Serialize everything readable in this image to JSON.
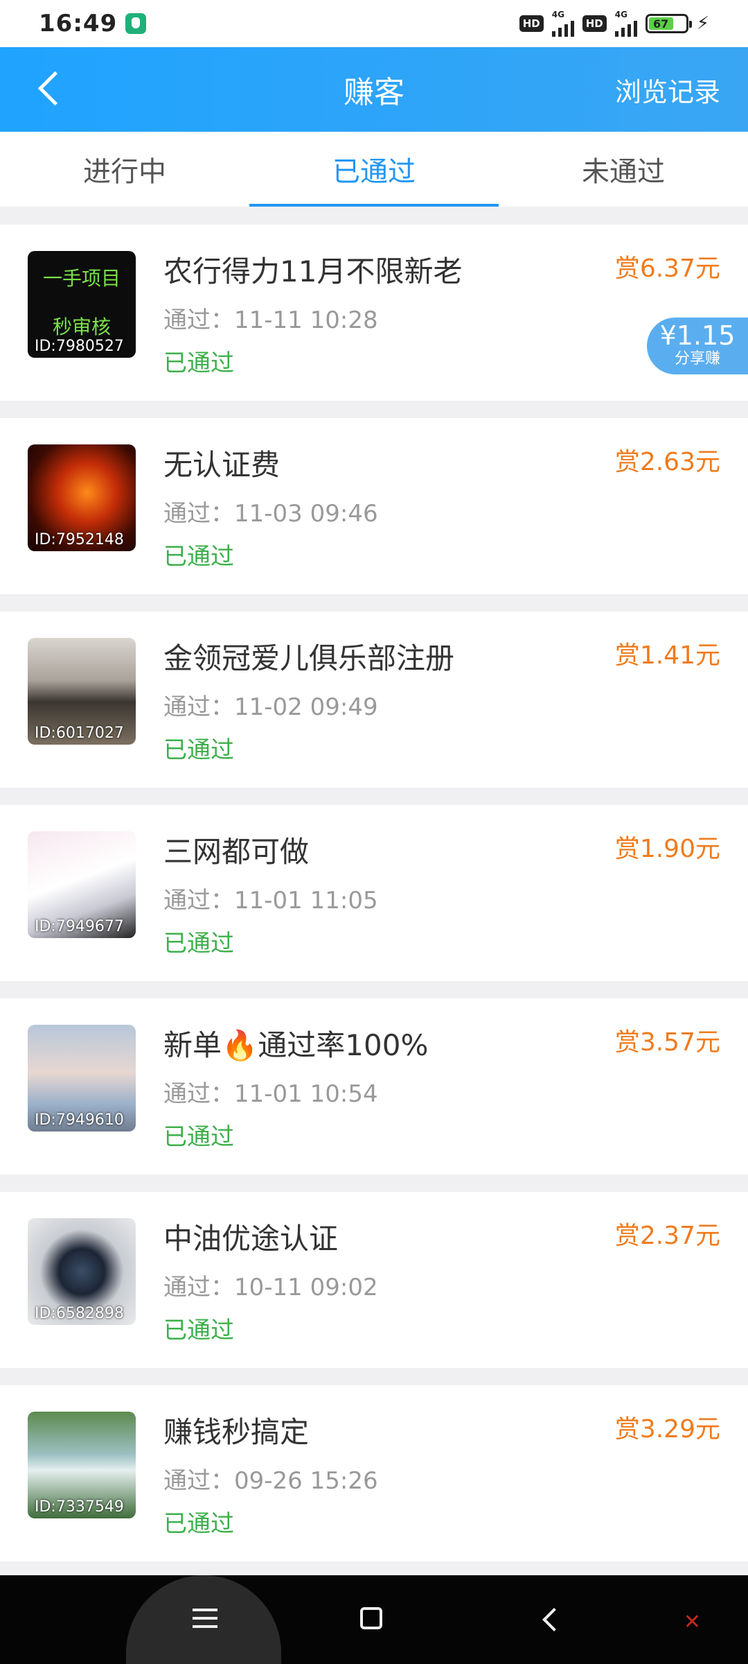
{
  "status_bar": {
    "time": "16:49",
    "hd1": "HD",
    "net1": "4G",
    "hd2": "HD",
    "net2": "4G",
    "battery": "67",
    "charging_icon": "bolt-icon"
  },
  "header": {
    "title": "赚客",
    "right_link": "浏览记录",
    "back_icon": "back-chevron-icon"
  },
  "tabs": [
    {
      "label": "进行中",
      "active": false
    },
    {
      "label": "已通过",
      "active": true
    },
    {
      "label": "未通过",
      "active": false
    }
  ],
  "thumb1": {
    "line1": "一手项目",
    "line2": "秒审核"
  },
  "share_badge": {
    "amount": "¥1.15",
    "label": "分享赚"
  },
  "items": [
    {
      "id": "ID:7980527",
      "title": "农行得力11月不限新老",
      "time": "通过：11-11 10:28",
      "status": "已通过",
      "reward": "赏6.37元"
    },
    {
      "id": "ID:7952148",
      "title": "无认证费",
      "time": "通过：11-03 09:46",
      "status": "已通过",
      "reward": "赏2.63元"
    },
    {
      "id": "ID:6017027",
      "title": "金领冠爱儿俱乐部注册",
      "time": "通过：11-02 09:49",
      "status": "已通过",
      "reward": "赏1.41元"
    },
    {
      "id": "ID:7949677",
      "title": "三网都可做",
      "time": "通过：11-01 11:05",
      "status": "已通过",
      "reward": "赏1.90元"
    },
    {
      "id": "ID:7949610",
      "title": "新单🔥通过率100%",
      "time": "通过：11-01 10:54",
      "status": "已通过",
      "reward": "赏3.57元"
    },
    {
      "id": "ID:6582898",
      "title": "中油优途认证",
      "time": "通过：10-11 09:02",
      "status": "已通过",
      "reward": "赏2.37元"
    },
    {
      "id": "ID:7337549",
      "title": "赚钱秒搞定",
      "time": "通过：09-26 15:26",
      "status": "已通过",
      "reward": "赏3.29元"
    }
  ],
  "colors": {
    "header_blue": "#1fa3ff",
    "tab_active": "#2196f3",
    "status_green": "#3db04a",
    "reward_orange": "#f07b1d"
  }
}
